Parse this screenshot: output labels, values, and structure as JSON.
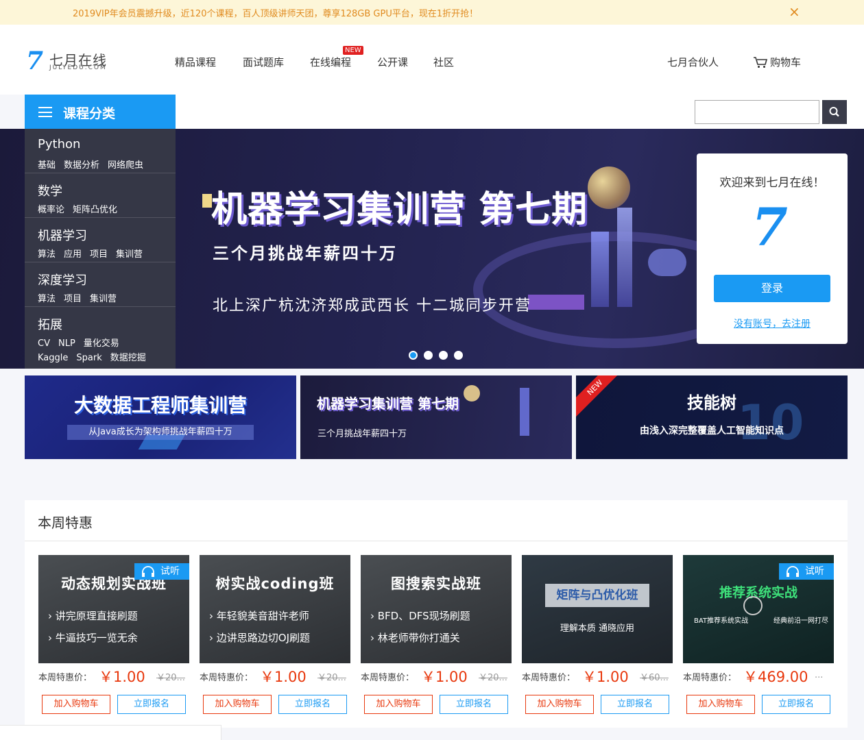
{
  "notice": {
    "text": "2019VIP年会员震撼升级，近120个课程，百人顶级讲师天团，尊享128GB GPU平台，现在1折开抢！",
    "close": "×"
  },
  "logo": {
    "mark": "7",
    "cn": "七月在线",
    "en": "JULYEDU.COM"
  },
  "nav": {
    "items": [
      "精品课程",
      "面试题库",
      "在线编程",
      "公开课",
      "社区"
    ],
    "badge": "NEW"
  },
  "header_right": {
    "partner": "七月合伙人",
    "cart": "购物车"
  },
  "category_bar": {
    "title": "课程分类"
  },
  "search": {
    "placeholder": ""
  },
  "categories": [
    {
      "name": "Python",
      "subs": [
        "基础",
        "数据分析",
        "网络爬虫"
      ]
    },
    {
      "name": "数学",
      "subs": [
        "概率论",
        "矩阵凸优化"
      ]
    },
    {
      "name": "机器学习",
      "subs": [
        "算法",
        "应用",
        "项目",
        "集训营"
      ]
    },
    {
      "name": "深度学习",
      "subs": [
        "算法",
        "项目",
        "集训营"
      ]
    },
    {
      "name": "拓展",
      "subs": [
        "CV",
        "NLP",
        "量化交易"
      ],
      "subs2": [
        "Kaggle",
        "Spark",
        "数据挖掘"
      ]
    }
  ],
  "hero": {
    "title": "机器学习集训营 第七期",
    "subtitle": "三个月挑战年薪四十万",
    "cities": "北上深广杭沈济郑成武西长  十二城同步开营",
    "slides": 4,
    "active_slide": 0
  },
  "login_card": {
    "welcome": "欢迎来到七月在线！",
    "mark": "7",
    "login": "登录",
    "register": "没有账号，去注册"
  },
  "banners": [
    {
      "title": "大数据工程师集训营",
      "subtitle": "从Java成长为架构师挑战年薪四十万"
    },
    {
      "title": "机器学习集训营 第七期",
      "subtitle": "三个月挑战年薪四十万"
    },
    {
      "title": "技能树",
      "subtitle": "由浅入深完整覆盖人工智能知识点",
      "badge": "NEW",
      "number": "10"
    }
  ],
  "deals": {
    "title": "本周特惠",
    "price_label": "本周特惠价：",
    "cart_button": "加入购物车",
    "enroll_button": "立即报名",
    "trial_tag": "试听",
    "courses": [
      {
        "title": "动态规划实战班",
        "line1": "› 讲完原理直接刷题",
        "line2": "› 牛逼技巧一览无余",
        "price": "￥1.00",
        "old": "￥20...",
        "trial": true
      },
      {
        "title": "树实战coding班",
        "line1": "› 年轻貌美音甜许老师",
        "line2": "› 边讲思路边切OJ刷题",
        "price": "￥1.00",
        "old": "￥20...",
        "trial": false
      },
      {
        "title": "图搜索实战班",
        "line1": "› BFD、DFS现场刷题",
        "line2": "› 林老师带你打通关",
        "price": "￥1.00",
        "old": "￥20...",
        "trial": false
      },
      {
        "title": "矩阵与凸优化班",
        "sub": "理解本质 通晓应用",
        "price": "￥1.00",
        "old": "￥60...",
        "trial": false
      },
      {
        "title": "推荐系统实战",
        "sub_left": "BAT推荐系统实战",
        "sub_right": "经典前沿一网打尽",
        "price": "￥469.00",
        "old": "...",
        "trial": true
      }
    ]
  }
}
